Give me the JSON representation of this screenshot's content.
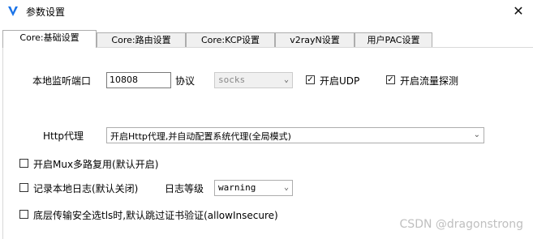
{
  "window": {
    "title": "参数设置",
    "close_glyph": "✕"
  },
  "tabs": [
    {
      "label": "Core:基础设置",
      "active": true
    },
    {
      "label": "Core:路由设置",
      "active": false
    },
    {
      "label": "Core:KCP设置",
      "active": false
    },
    {
      "label": "v2rayN设置",
      "active": false
    },
    {
      "label": "用户PAC设置",
      "active": false
    }
  ],
  "basic": {
    "local_port_label": "本地监听端口",
    "local_port_value": "10808",
    "protocol_label": "协议",
    "protocol_value": "socks",
    "enable_udp_label": "开启UDP",
    "enable_udp_checked": true,
    "enable_sniffing_label": "开启流量探测",
    "enable_sniffing_checked": true,
    "http_proxy_label": "Http代理",
    "http_proxy_value": "开启Http代理,并自动配置系统代理(全局模式)",
    "mux_label": "开启Mux多路复用(默认开启)",
    "mux_checked": false,
    "log_label": "记录本地日志(默认关闭)",
    "log_checked": false,
    "log_level_label": "日志等级",
    "log_level_value": "warning",
    "allow_insecure_label": "底层传输安全选tls时,默认跳过证书验证(allowInsecure)",
    "allow_insecure_checked": false
  },
  "watermark": "CSDN @dragonstrong",
  "icons": {
    "app": "v2rayn-logo-icon",
    "dropdown": "chevron-down-icon",
    "check": "checkmark-icon",
    "close": "close-icon"
  },
  "colors": {
    "accent": "#1a73e8",
    "tab_inactive": "#f0f0f0",
    "border": "#adadad"
  }
}
